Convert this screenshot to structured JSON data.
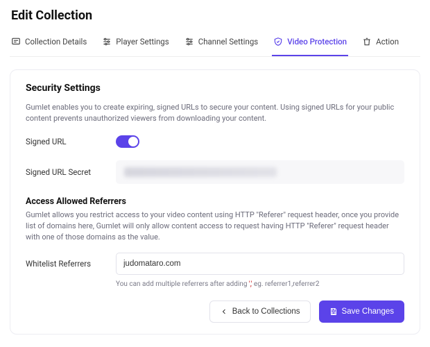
{
  "page_title": "Edit Collection",
  "tabs": {
    "details": "Collection Details",
    "player": "Player Settings",
    "channel": "Channel Settings",
    "video_protection": "Video Protection",
    "action": "Action"
  },
  "security": {
    "title": "Security Settings",
    "description": "Gumlet enables you to create expiring, signed URLs to secure your content. Using signed URLs for your public content prevents unauthorized viewers from downloading your content.",
    "signed_url_label": "Signed URL",
    "signed_url_enabled": true,
    "signed_url_secret_label": "Signed URL Secret"
  },
  "referrers": {
    "title": "Access Allowed Referrers",
    "description": "Gumlet allows you restrict access to your video content using HTTP \"Referer\" request header, once you provide list of domains here, Gumlet will only allow content access to request having HTTP \"Referer\" request header with one of those domains as the value.",
    "whitelist_label": "Whitelist Referrers",
    "whitelist_value": "judomataro.com",
    "hint_prefix": "You can add multiple referrers after adding ",
    "hint_sep": "','",
    "hint_suffix": " eg. referrer1,referrer2"
  },
  "actions": {
    "back": "Back to Collections",
    "save": "Save Changes"
  }
}
